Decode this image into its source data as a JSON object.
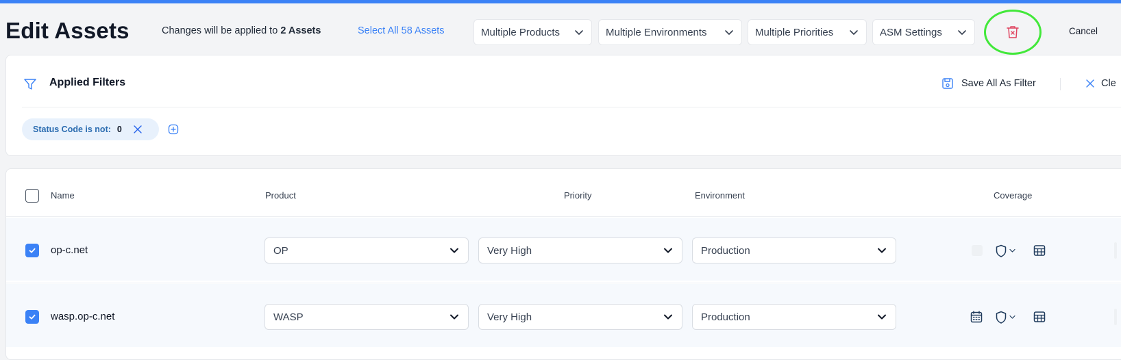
{
  "header": {
    "title": "Edit Assets",
    "changes_prefix": "Changes will be applied to",
    "changes_count": "2 Assets",
    "select_all": "Select All 58 Assets",
    "dropdowns": [
      "Multiple Products",
      "Multiple Environments",
      "Multiple Priorities",
      "ASM Settings"
    ],
    "cancel": "Cancel"
  },
  "filters": {
    "title": "Applied Filters",
    "save_all": "Save All As Filter",
    "clear": "Cle",
    "chip": {
      "label": "Status Code is not:",
      "value": "0"
    }
  },
  "table": {
    "columns": {
      "name": "Name",
      "product": "Product",
      "priority": "Priority",
      "environment": "Environment",
      "coverage": "Coverage"
    },
    "rows": [
      {
        "name": "op-c.net",
        "product": "OP",
        "priority": "Very High",
        "environment": "Production",
        "checked": true
      },
      {
        "name": "wasp.op-c.net",
        "product": "WASP",
        "priority": "Very High",
        "environment": "Production",
        "checked": true
      }
    ]
  },
  "colors": {
    "accent": "#3b82f6",
    "link": "#3b82f6",
    "delete_icon": "#e0435f",
    "highlight_circle": "#42e83a",
    "chip_bg": "#e8f1fc"
  },
  "icons": {
    "filter": "filter-icon",
    "save": "save-icon",
    "clear": "close-icon",
    "delete": "trash-icon",
    "chevron": "chevron-down-icon",
    "shield": "shield-icon",
    "calendar": "calendar-icon",
    "table": "table-icon",
    "add": "plus-circle-icon"
  }
}
